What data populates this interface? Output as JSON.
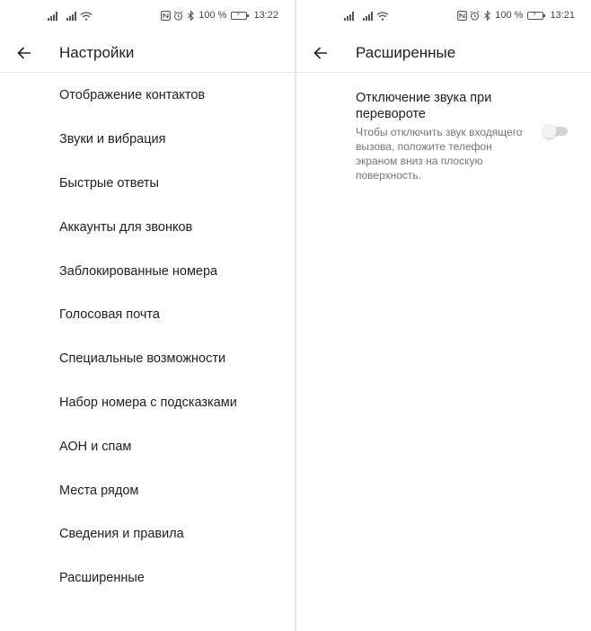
{
  "left": {
    "status": {
      "battery_pct": "100 %",
      "time": "13:22"
    },
    "title": "Настройки",
    "menu": [
      "Отображение контактов",
      "Звуки и вибрация",
      "Быстрые ответы",
      "Аккаунты для звонков",
      "Заблокированные номера",
      "Голосовая почта",
      "Специальные возможности",
      "Набор номера с подсказками",
      "АОН и спам",
      "Места рядом",
      "Сведения и правила",
      "Расширенные"
    ]
  },
  "right": {
    "status": {
      "battery_pct": "100 %",
      "time": "13:21"
    },
    "title": "Расширенные",
    "pref": {
      "title": "Отключение звука при перевороте",
      "summary": "Чтобы отключить звук входящего вызова, положите телефон экраном вниз на плоскую поверхность.",
      "enabled": false
    }
  },
  "icons": {
    "back": "arrow-left-icon",
    "signal": "signal-icon",
    "wifi": "wifi-icon",
    "nfc": "nfc-icon",
    "alarm": "alarm-icon",
    "bluetooth": "bluetooth-icon",
    "battery": "battery-icon"
  },
  "colors": {
    "background": "#ffffff",
    "text_primary": "#202124",
    "text_secondary": "#757575",
    "divider": "#e4e4e4",
    "toggle_track_off": "#d4d4d4",
    "toggle_thumb_off": "#f1f1f1"
  }
}
